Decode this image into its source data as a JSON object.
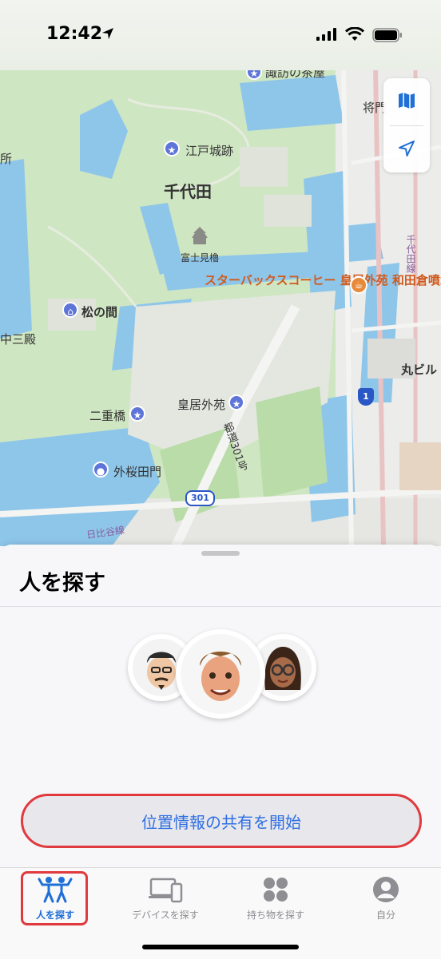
{
  "status_bar": {
    "time": "12:42"
  },
  "map": {
    "labels": {
      "suwa": "諏訪の茶屋",
      "shogun": "将門",
      "edo_castle": "江戸城跡",
      "chiyoda": "千代田",
      "fujimi": "富士見櫓",
      "starbucks": "スターバックスコーヒー 皇居外苑 和田倉噴水公園店",
      "matsu": "松の間",
      "nakasanden": "中三殿",
      "nijubashi": "二重橋",
      "kokyo_gaien": "皇居外苑",
      "sotosakurada": "外桜田門",
      "marubiru": "丸ビル",
      "hibiya": "日比谷線",
      "chiyoda_line": "千代田線",
      "route_road": "都道301号",
      "route_301": "301",
      "route_1": "1",
      "sho": "所"
    }
  },
  "sheet": {
    "title": "人を探す",
    "share_button": "位置情報の共有を開始"
  },
  "tabs": [
    {
      "label": "人を探す",
      "icon": "people-icon",
      "active": true
    },
    {
      "label": "デバイスを探す",
      "icon": "devices-icon",
      "active": false
    },
    {
      "label": "持ち物を探す",
      "icon": "items-grid-icon",
      "active": false
    },
    {
      "label": "自分",
      "icon": "person-circle-icon",
      "active": false
    }
  ],
  "colors": {
    "accent": "#1f6fd7",
    "highlight": "#e03a3e",
    "water": "#8ec6ea",
    "park": "#cfe6c2"
  }
}
